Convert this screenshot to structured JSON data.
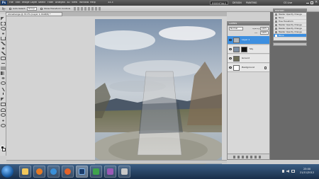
{
  "app": {
    "logo_text": "Ps",
    "menus": [
      "File",
      "Edit",
      "Image",
      "Layer",
      "Select",
      "Filter",
      "Analysis",
      "3D",
      "View",
      "Window",
      "Help"
    ],
    "zoom": "33.3",
    "workspaces": [
      "ESSENTIALS",
      "DESIGN",
      "PAINTING"
    ],
    "active_workspace": "ESSENTIALS",
    "cs_live": "CS Live"
  },
  "options": {
    "auto_select": "Auto-Select:",
    "auto_select_value": "Group",
    "show_transform": "Show Transform Controls"
  },
  "document": {
    "tab_label": "stonehenge @ 33.3% (Layer 1, RGB/8) *"
  },
  "layers_panel": {
    "tab": "LAYERS",
    "blend_mode": "Normal",
    "opacity_label": "Opacity:",
    "opacity_value": "100%",
    "fill_label": "Fill:",
    "fill_value": "100%",
    "layers": [
      {
        "name": "Layer 1",
        "selected": true
      },
      {
        "name": "Sky",
        "selected": false
      },
      {
        "name": "Ground",
        "selected": false
      },
      {
        "name": "Background",
        "selected": false
      }
    ]
  },
  "history_panel": {
    "tab": "HISTORY",
    "items": [
      {
        "label": "Master Opacity Change",
        "selected": false
      },
      {
        "label": "Move",
        "selected": false
      },
      {
        "label": "Free Transform",
        "selected": false
      },
      {
        "label": "Master Opacity Change",
        "selected": false
      },
      {
        "label": "Master Opacity Change",
        "selected": false
      },
      {
        "label": "Master Opacity Change",
        "selected": false
      },
      {
        "label": "Move",
        "selected": true
      }
    ]
  },
  "taskbar": {
    "time": "23:00",
    "date": "21/11/2012"
  },
  "colors": {
    "selection_blue": "#3d8fe0",
    "taskbar": "#1a2f4a"
  }
}
